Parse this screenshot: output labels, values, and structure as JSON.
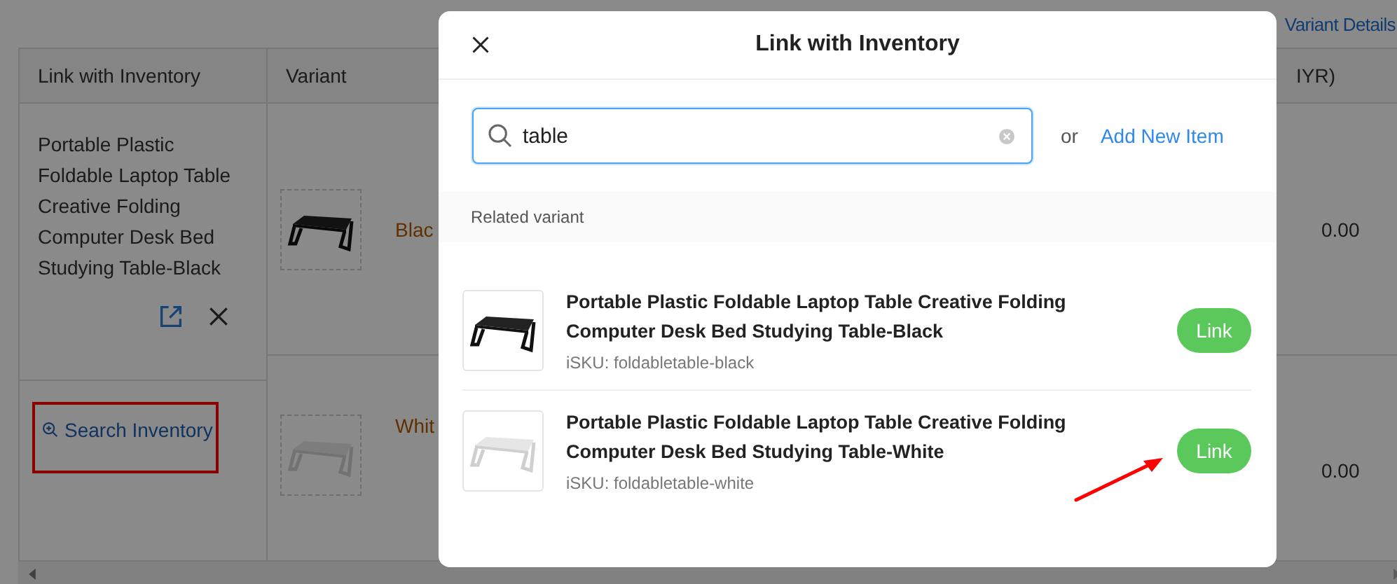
{
  "page": {
    "header_link": "Variant Details"
  },
  "table": {
    "columns": [
      "Link with Inventory",
      "Variant",
      "IYR)"
    ],
    "rows": [
      {
        "linked": true,
        "inventory_name": "Portable Plastic Foldable Laptop Table Creative Folding Computer Desk Bed Studying Table-Black",
        "variant": "Blac",
        "price": "0.00"
      },
      {
        "linked": false,
        "annotated": true,
        "search_link": "Search Inventory",
        "variant": "Whit",
        "price": "0.00"
      }
    ]
  },
  "modal": {
    "title": "Link with Inventory",
    "search": {
      "value": "table"
    },
    "or_text": "or",
    "add_link": "Add New Item",
    "section_label": "Related variant",
    "results": [
      {
        "name": "Portable Plastic Foldable Laptop Table Creative Folding Computer Desk Bed Studying Table-Black",
        "sku": "iSKU: foldabletable-black",
        "button": "Link"
      },
      {
        "name": "Portable Plastic Foldable Laptop Table Creative Folding Computer Desk Bed Studying Table-White",
        "sku": "iSKU: foldabletable-white",
        "button": "Link",
        "annotated": true
      }
    ]
  }
}
